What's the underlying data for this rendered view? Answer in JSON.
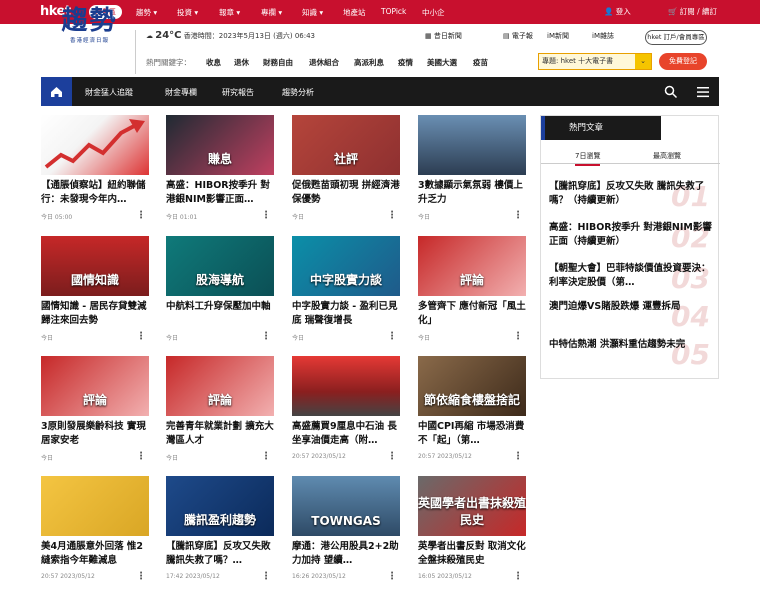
{
  "topbar": {
    "logo": "hket",
    "paid": "付費區",
    "nav": [
      "趨勢",
      "投資",
      "報章",
      "專欄",
      "知識",
      "地產站",
      "TOPick",
      "中小企"
    ],
    "login": "登入",
    "subscribe": "訂閱 / 續訂"
  },
  "brand": {
    "title": "趨勢",
    "subtitle": "香港經濟日報"
  },
  "weather": {
    "temp": "24°C",
    "text": "香港時間：2023年5月13日 (週六) 06:43"
  },
  "header_links": [
    "昔日新聞",
    "電子報",
    "iM新聞",
    "iM雜誌"
  ],
  "header_button": "hket 訂戶/會員專區",
  "hot": {
    "label": "熱門關鍵字：",
    "keywords": [
      "收息",
      "退休",
      "財務自由",
      "退休組合",
      "高派利息",
      "疫情",
      "美國大選",
      "疫苗"
    ]
  },
  "special": {
    "label": "專題: hket 十大電子書",
    "arrow": "⌄"
  },
  "register": "免費登記",
  "navbar": {
    "items": [
      "財金猛人追蹤",
      "財金專欄",
      "研究報告",
      "趨勢分析"
    ]
  },
  "cards": [
    {
      "title": "【通脹偵察站】紐約聯儲行：未發現今年内…",
      "meta": "今日 05:00"
    },
    {
      "title": "高盛：HIBOR按季升 對港銀NIM影響正面…",
      "meta": "今日 01:01"
    },
    {
      "title": "促俄甦苗頭初現 拼經濟港保優勢",
      "meta": "今日"
    },
    {
      "title": "3數據顯示氣氛弱 樓價上升乏力",
      "meta": "今日"
    },
    {
      "title": "國情知識 - 居民存貸雙減 歸注來回去勢",
      "meta": "今日"
    },
    {
      "title": "中航料工升穿保壓加中軸",
      "meta": "今日"
    },
    {
      "title": "中字股實力談 - 盈利已見底 瑞聲復增長",
      "meta": "今日"
    },
    {
      "title": "多管齊下 應付新冠「風土化」",
      "meta": "今日"
    },
    {
      "title": "3原則發展樂齡科技 實現居家安老",
      "meta": "今日"
    },
    {
      "title": "完善青年就業計劃 擴充大灣區人才",
      "meta": "今日"
    },
    {
      "title": "高盛薦買9厘息中石油 長坐享油價走高（附…",
      "meta": "20:57 2023/05/12"
    },
    {
      "title": "中國CPI再縮 市場恐消費不「起」（第…",
      "meta": "20:57 2023/05/12"
    },
    {
      "title": "美4月通脹意外回落 惟2縫索指今年難減息",
      "meta": "20:57 2023/05/12"
    },
    {
      "title": "【騰訊穿底】反攻又失敗 騰訊失救了嗎？…",
      "meta": "17:42 2023/05/12"
    },
    {
      "title": "摩通：港公用股具2+2助力加持 望續…",
      "meta": "16:26 2023/05/12"
    },
    {
      "title": "英學者出書反對 取消文化全盤抹殺殖民史",
      "meta": "16:05 2023/05/12"
    }
  ],
  "thumb_captions": [
    "",
    "賺息",
    "社評",
    "",
    "國情知識",
    "股海導航",
    "中字股實力談",
    "評論",
    "評論",
    "評論",
    "",
    "節依縮食樓盤捨記",
    "",
    "騰訊盈利趨勢",
    "TOWNGAS",
    "英國學者出書抹殺殖民史"
  ],
  "hotbox": {
    "title": "熱門文章",
    "tabs": [
      "7日瀏覽",
      "最高瀏覽"
    ],
    "items": [
      {
        "num": "01",
        "title": "【騰訊穿底】反攻又失敗 騰訊失救了嗎？（持續更新）"
      },
      {
        "num": "02",
        "title": "高盛：HIBOR按季升 對港銀NIM影響正面（持續更新）"
      },
      {
        "num": "03",
        "title": "【朝聖大會】巴菲特談價值投資要決：利率決定股價（第…"
      },
      {
        "num": "04",
        "title": "澳門迫爆VS賭股跌爆 運豐拆局"
      },
      {
        "num": "05",
        "title": "中特估熱潮 洪灝料重估趨勢未完"
      }
    ]
  },
  "colors": {
    "brand_red": "#c8102e",
    "brand_blue": "#1c3f9c",
    "nav_dark": "#1a1a1a"
  }
}
